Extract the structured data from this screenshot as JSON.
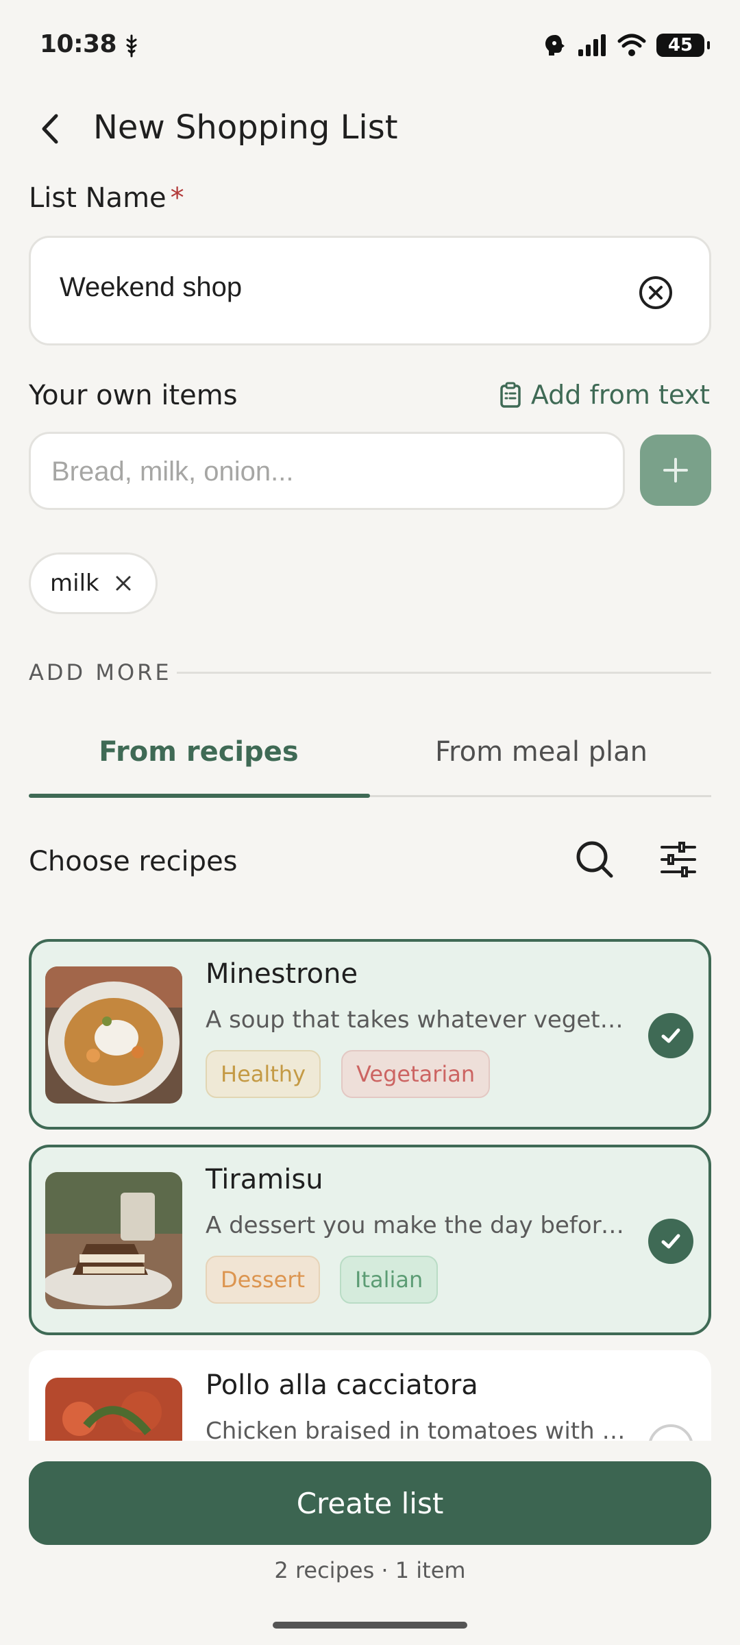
{
  "status_bar": {
    "time": "10:38",
    "battery": "45"
  },
  "header": {
    "title": "New Shopping List"
  },
  "list_name": {
    "label": "List Name",
    "required_mark": "*",
    "value": "Weekend shop"
  },
  "own_items": {
    "label": "Your own items",
    "add_from_text": "Add from text",
    "placeholder": "Bread, milk, onion...",
    "chips": [
      "milk"
    ]
  },
  "add_more": {
    "label": "ADD MORE"
  },
  "tabs": [
    {
      "label": "From recipes",
      "active": true
    },
    {
      "label": "From meal plan",
      "active": false
    }
  ],
  "recipes_section": {
    "title": "Choose recipes"
  },
  "recipes": [
    {
      "title": "Minestrone",
      "desc": "A soup that takes whatever vegeta...",
      "tags": [
        "Healthy",
        "Vegetarian"
      ],
      "selected": true
    },
    {
      "title": "Tiramisu",
      "desc": "A dessert you make the day before...",
      "tags": [
        "Dessert",
        "Italian"
      ],
      "selected": true
    },
    {
      "title": "Pollo alla cacciatora",
      "desc": "Chicken braised in tomatoes with o...",
      "tags": [],
      "selected": false
    }
  ],
  "footer": {
    "create_label": "Create list",
    "summary": "2 recipes · 1 item"
  },
  "colors": {
    "accent": "#3f6a55",
    "add_button": "#7aa18a",
    "selected_card_bg": "#e8f2eb",
    "background": "#f6f5f2"
  }
}
